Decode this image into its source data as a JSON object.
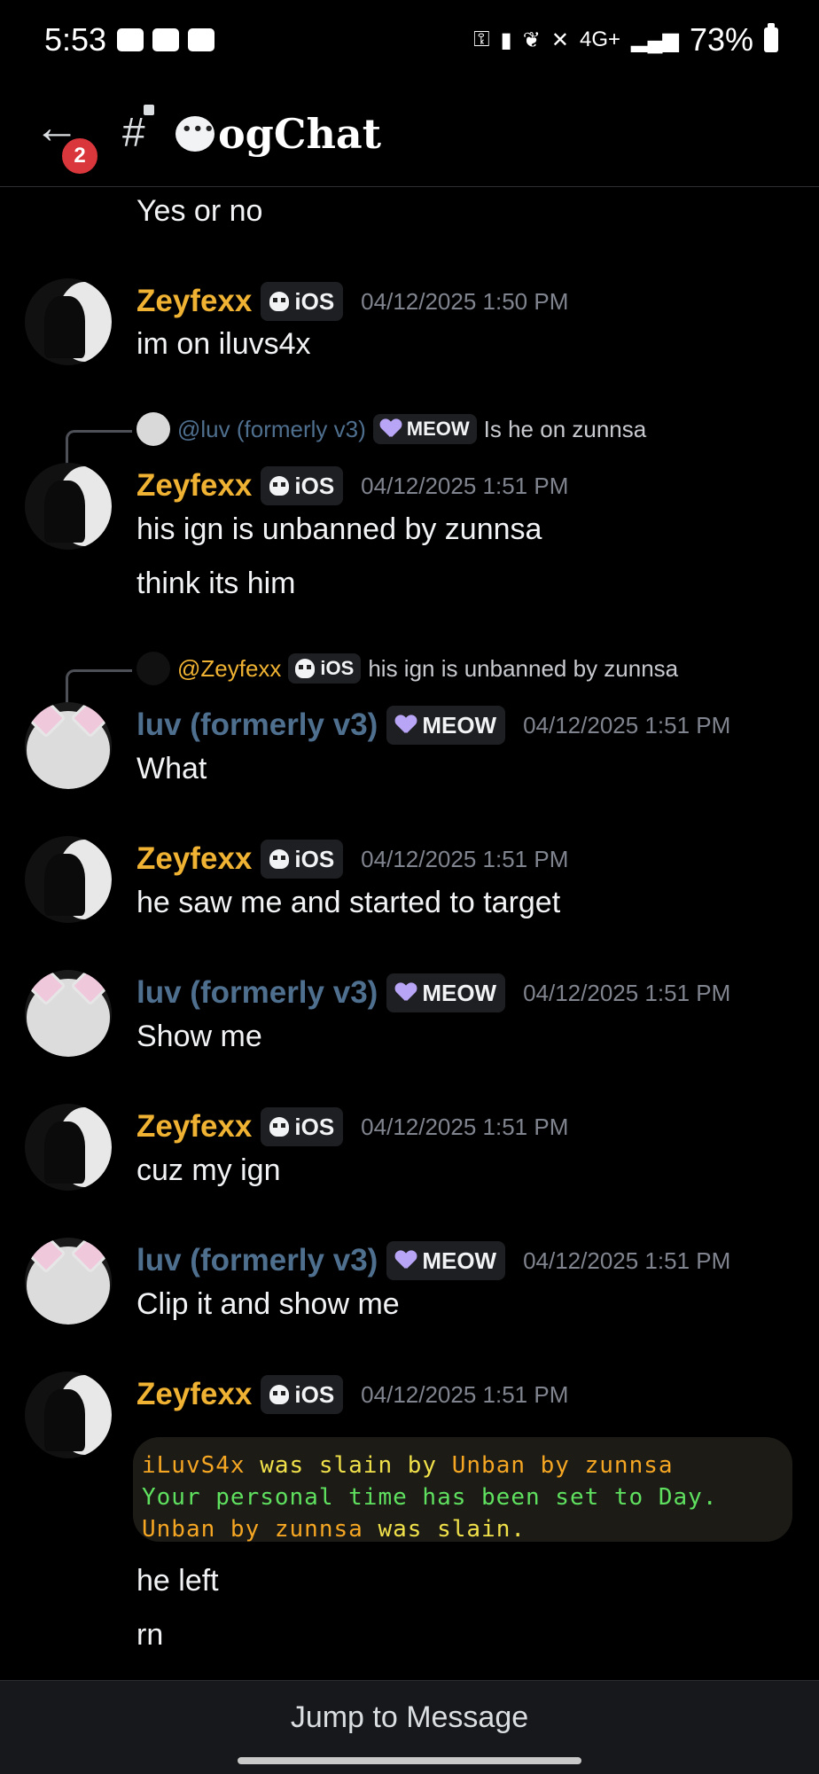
{
  "status_bar": {
    "time": "5:53",
    "network": "4G+",
    "battery": "73%"
  },
  "header": {
    "back_badge": "2",
    "channel_hash": "#",
    "channel_name": "ogChat"
  },
  "messages": {
    "m0_text": "Yes or no",
    "m1": {
      "user": "Zeyfexx",
      "tag": "iOS",
      "time": "04/12/2025 1:50 PM",
      "text": "im on iluvs4x"
    },
    "m2_reply": {
      "user": "@luv (formerly v3)",
      "tag": "MEOW",
      "text": "Is he on zunnsa"
    },
    "m2": {
      "user": "Zeyfexx",
      "tag": "iOS",
      "time": "04/12/2025 1:51 PM",
      "text1": "his ign is unbanned by zunnsa",
      "text2": "think its him"
    },
    "m3_reply": {
      "user": "@Zeyfexx",
      "tag": "iOS",
      "text": "his ign is unbanned by zunnsa"
    },
    "m3": {
      "user": "luv (formerly v3)",
      "tag": "MEOW",
      "time": "04/12/2025 1:51 PM",
      "text": "What"
    },
    "m4": {
      "user": "Zeyfexx",
      "tag": "iOS",
      "time": "04/12/2025 1:51 PM",
      "text": "he saw me and started to target"
    },
    "m5": {
      "user": "luv (formerly v3)",
      "tag": "MEOW",
      "time": "04/12/2025 1:51 PM",
      "text": "Show me"
    },
    "m6": {
      "user": "Zeyfexx",
      "tag": "iOS",
      "time": "04/12/2025 1:51 PM",
      "text": "cuz my ign"
    },
    "m7": {
      "user": "luv (formerly v3)",
      "tag": "MEOW",
      "time": "04/12/2025 1:51 PM",
      "text": "Clip it and show me"
    },
    "m8": {
      "user": "Zeyfexx",
      "tag": "iOS",
      "time": "04/12/2025 1:51 PM",
      "gamelog": {
        "l1a": "iLuvS4x",
        "l1b": " was slain by ",
        "l1c": "Unban by zunnsa",
        "l2": "Your personal time has been set to Day.",
        "l3a": "Unban by zunnsa",
        "l3b": " was slain."
      },
      "text1": "he left",
      "text2": "rn"
    }
  },
  "bottom": {
    "jump_label": "Jump to Message"
  },
  "colors": {
    "gold_name": "#f0b232",
    "blue_name": "#4f6f8f",
    "background": "#000000"
  }
}
